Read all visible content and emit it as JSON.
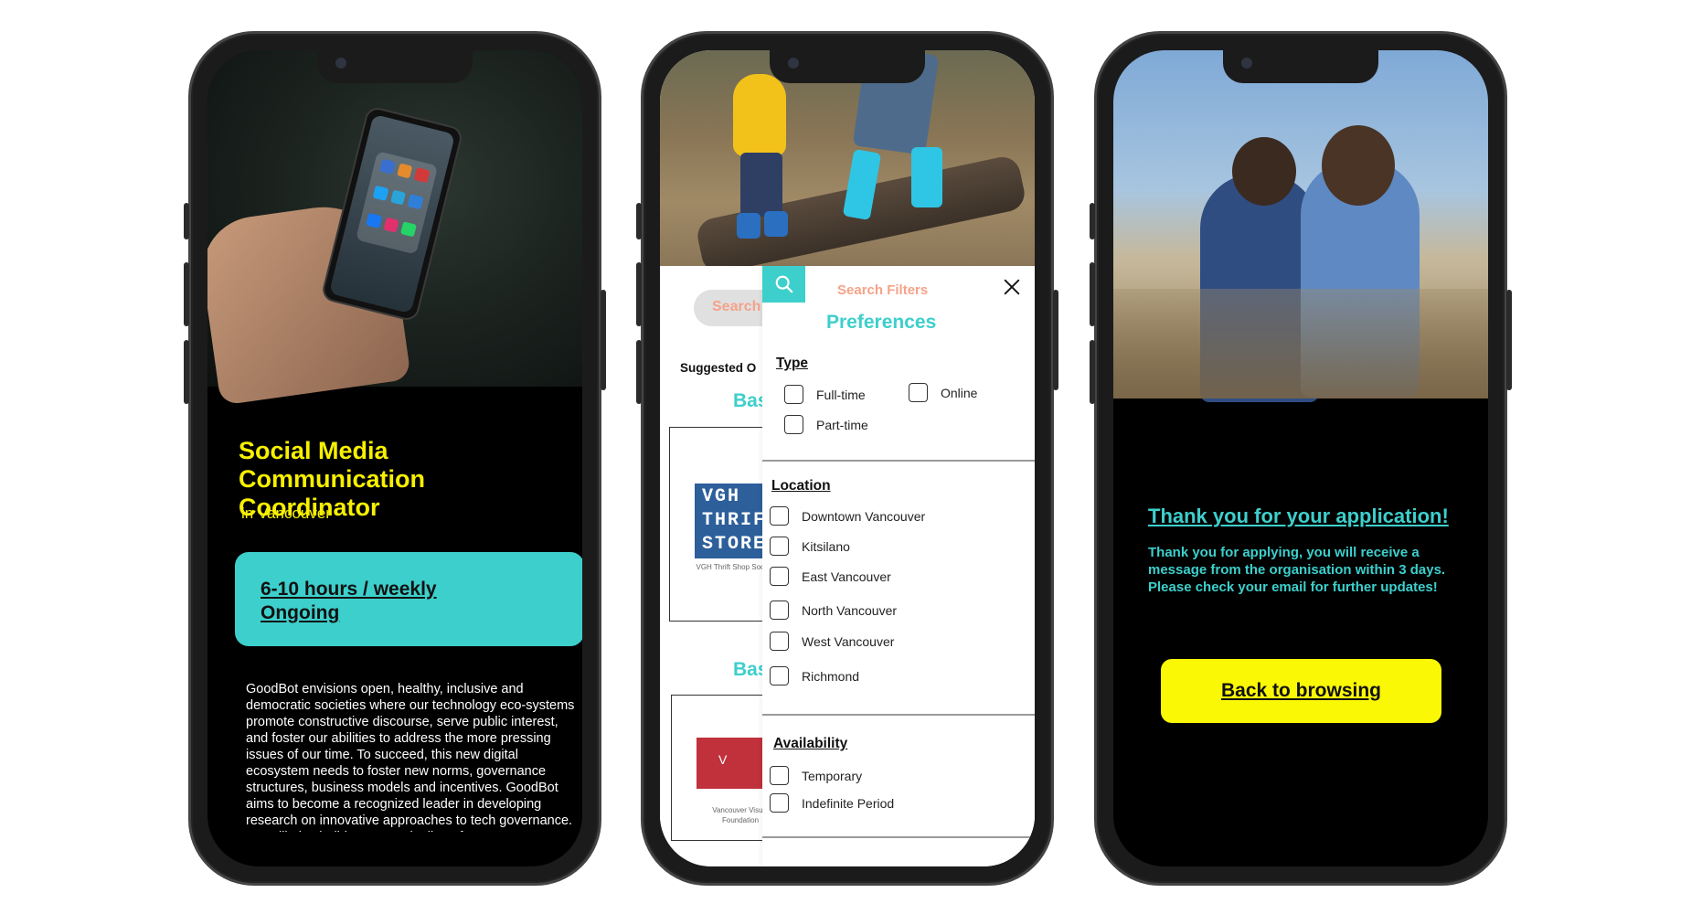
{
  "phone1": {
    "job_title": "Social Media Communication Coordinator",
    "location": "in Vancouver",
    "hours": "6-10 hours / weekly",
    "duration": "Ongoing",
    "description": "GoodBot envisions open, healthy, inclusive and democratic societies where our technology eco-systems promote constructive discourse, serve public interest, and foster our abilities to address the more pressing issues of our time. To succeed, this new digital ecosystem needs to foster new norms, governance structures, business models and incentives. GoodBot aims to become a recognized leader in developing research on innovative approaches to tech governance. We will also build a strong pipeline of non",
    "photo_device_label": "social media"
  },
  "phone2": {
    "search_placeholder": "Search",
    "suggested_label": "Suggested O",
    "section_heading_1": "Bas",
    "section_heading_2": "Bas",
    "org1_logo": [
      "VGH",
      "THRIF",
      "STORE"
    ],
    "org1_name": "VGH Thrift Shop Society",
    "org2_logo": "V",
    "org2_name": "Vancouver Visual Foundation",
    "filters_title": "Search Filters",
    "preferences_label": "Preferences",
    "type_title": "Type",
    "type_options": [
      "Full-time",
      "Online",
      "Part-time"
    ],
    "location_title": "Location",
    "location_options": [
      "Downtown Vancouver",
      "Kitsilano",
      "East Vancouver",
      "North Vancouver",
      "West Vancouver",
      "Richmond"
    ],
    "availability_title": "Availability",
    "availability_options": [
      "Temporary",
      "Indefinite Period"
    ],
    "colors": {
      "accent": "#3dcfcc",
      "search_text": "#f4a38a"
    }
  },
  "phone3": {
    "title": "Thank you for your application!",
    "message": "Thank you for applying, you will receive a message from the organisation within 3 days. Please check your email for further updates!",
    "back_button": "Back to browsing",
    "colors": {
      "accent": "#3dcfcc",
      "button": "#fbf806"
    }
  }
}
